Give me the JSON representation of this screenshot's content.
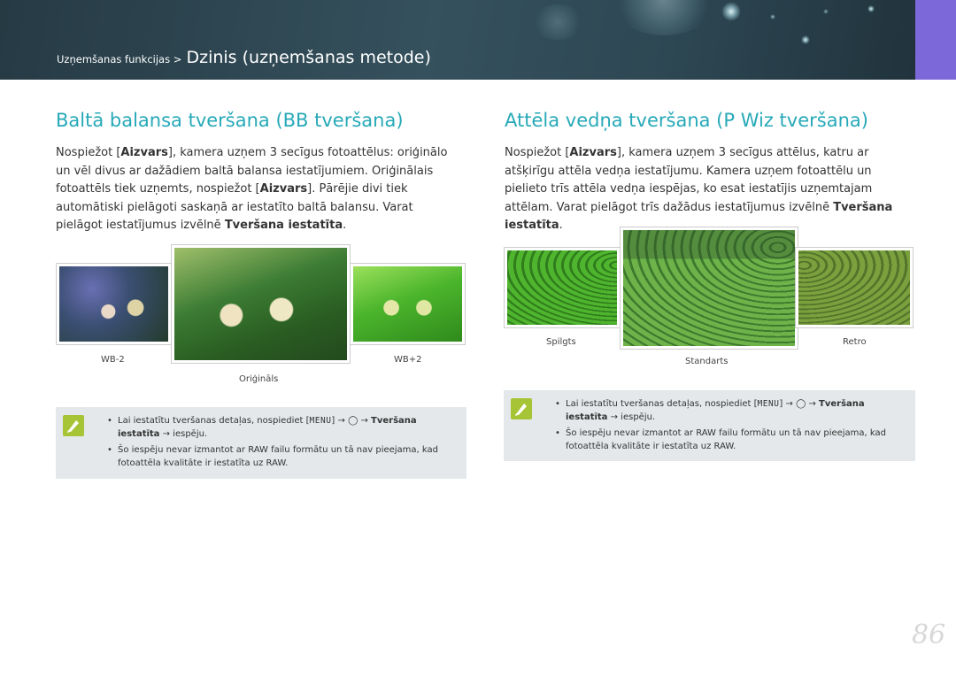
{
  "header": {
    "breadcrumb_small": "Uzņemšanas funkcijas >",
    "breadcrumb_big": "Dzinis (uzņemšanas metode)"
  },
  "left": {
    "title": "Baltā balansa tveršana (BB tveršana)",
    "p1": "Nospiežot [",
    "key1": "Aizvars",
    "p2": "], kamera uzņem 3 secīgus fotoattēlus: oriģinālo un vēl divus ar dažādiem baltā balansa iestatījumiem. Oriģinālais fotoattēls tiek uzņemts, nospiežot [",
    "key2": "Aizvars",
    "p3": "]. Pārējie divi tiek automātiski pielāgoti saskaņā ar iestatīto baltā balansu. Varat pielāgot iestatījumus izvēlnē ",
    "menu_bold": "Tveršana iestatīta",
    "p4": ".",
    "captions": {
      "left": "WB-2",
      "center": "Oriģināls",
      "right": "WB+2"
    },
    "note": {
      "b1_pre": "Lai iestatītu tveršanas detaļas, nospiediet [",
      "b1_menu": "MENU",
      "b1_mid": "] → ",
      "b1_icon": "camera-icon",
      "b1_arrow": " → ",
      "b1_bold": "Tveršana iestatīta",
      "b1_post": " → iespēju.",
      "b2": "Šo iespēju nevar izmantot ar RAW failu formātu un tā nav pieejama, kad fotoattēla kvalitāte ir iestatīta uz RAW."
    }
  },
  "right": {
    "title": "Attēla vedņa tveršana (P Wiz tveršana)",
    "p1": "Nospiežot [",
    "key1": "Aizvars",
    "p2": "], kamera uzņem 3 secīgus attēlus, katru ar atšķirīgu attēla vedņa iestatījumu. Kamera uzņem fotoattēlu un pielieto trīs attēla vedņa iespējas, ko esat iestatījis uzņemtajam attēlam. Varat pielāgot trīs dažādus iestatījumus izvēlnē ",
    "menu_bold": "Tveršana iestatīta",
    "p3": ".",
    "captions": {
      "left": "Spilgts",
      "center": "Standarts",
      "right": "Retro"
    },
    "note": {
      "b1_pre": "Lai iestatītu tveršanas detaļas, nospiediet [",
      "b1_menu": "MENU",
      "b1_mid": "] → ",
      "b1_arrow": " → ",
      "b1_bold": "Tveršana iestatīta",
      "b1_post": " → iespēju.",
      "b2": "Šo iespēju nevar izmantot ar RAW failu formātu un tā nav pieejama, kad fotoattēla kvalitāte ir iestatīta uz RAW."
    }
  },
  "page_number": "86",
  "colors": {
    "title": "#27a9b8",
    "accent_tab": "#7c68d8",
    "note_bg": "#e4e8ea",
    "pen_icon": "#a6c435"
  }
}
